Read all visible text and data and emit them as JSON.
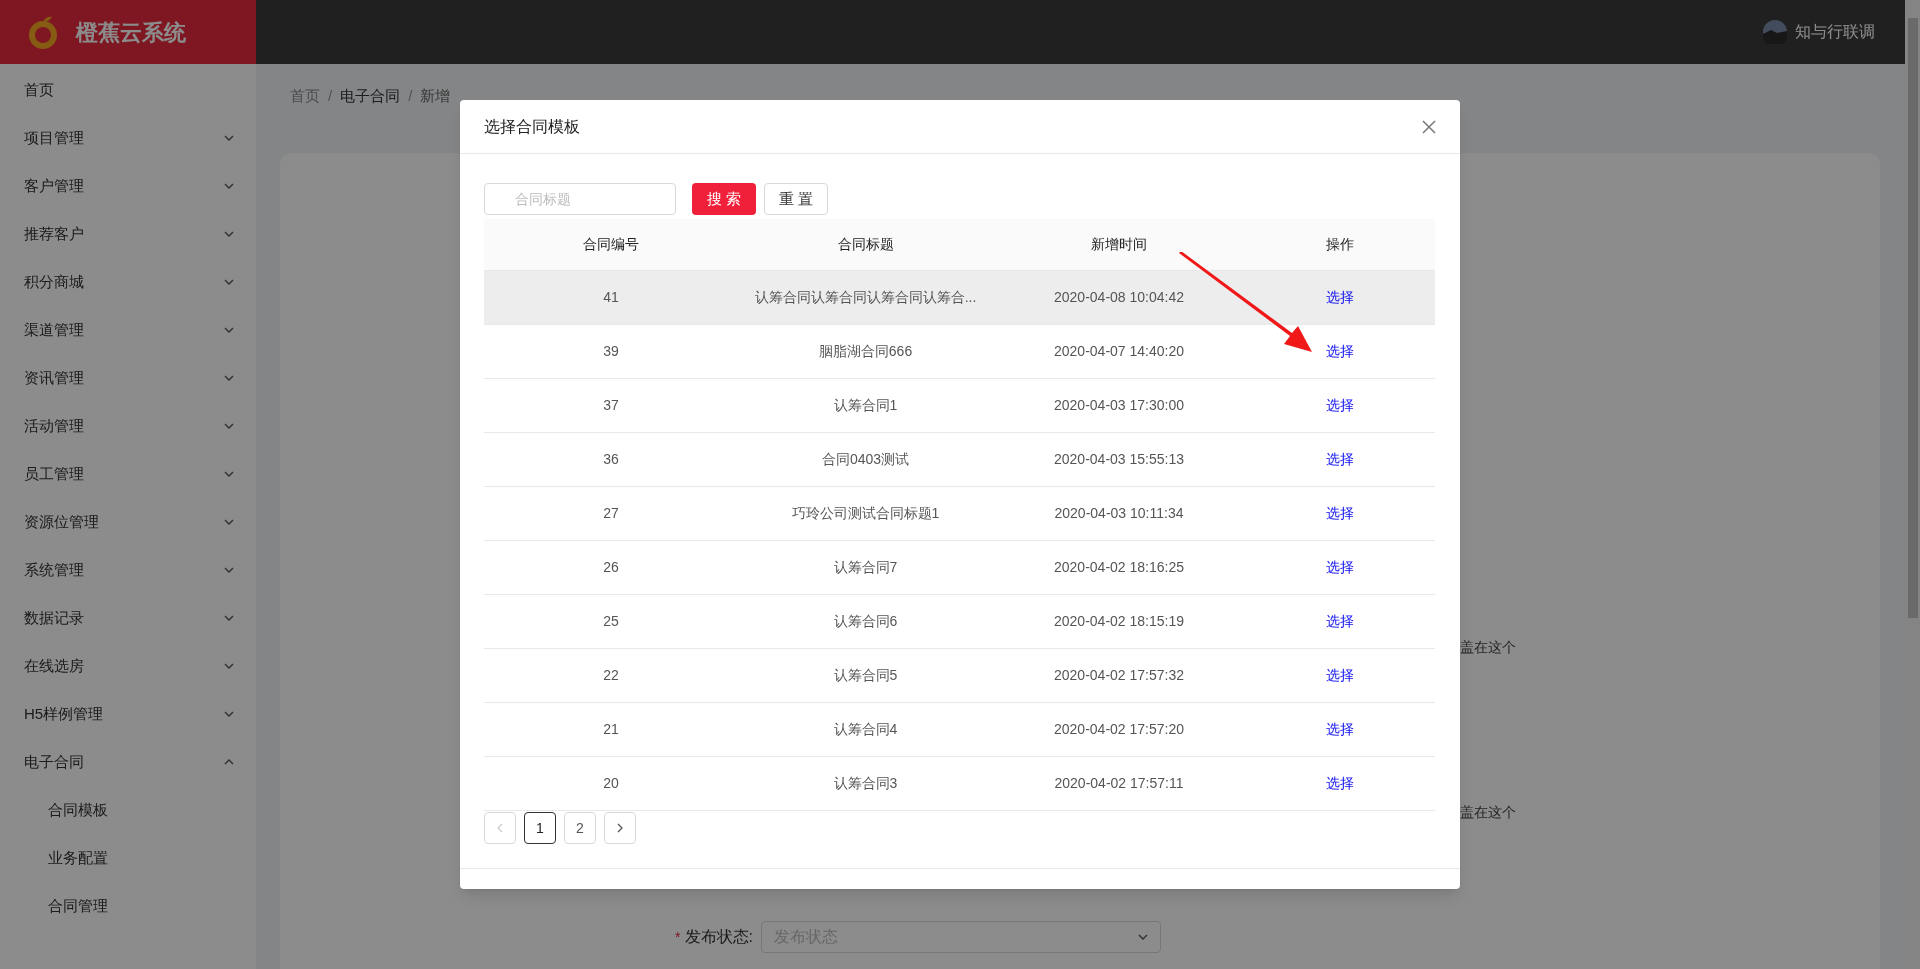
{
  "app": {
    "name": "橙蕉云系统"
  },
  "user": {
    "name": "知与行联调"
  },
  "sidebar": {
    "items": [
      {
        "label": "首页",
        "kind": "link"
      },
      {
        "label": "项目管理",
        "kind": "group",
        "expanded": false
      },
      {
        "label": "客户管理",
        "kind": "group",
        "expanded": false
      },
      {
        "label": "推荐客户",
        "kind": "group",
        "expanded": false
      },
      {
        "label": "积分商城",
        "kind": "group",
        "expanded": false
      },
      {
        "label": "渠道管理",
        "kind": "group",
        "expanded": false
      },
      {
        "label": "资讯管理",
        "kind": "group",
        "expanded": false
      },
      {
        "label": "活动管理",
        "kind": "group",
        "expanded": false
      },
      {
        "label": "员工管理",
        "kind": "group",
        "expanded": false
      },
      {
        "label": "资源位管理",
        "kind": "group",
        "expanded": false
      },
      {
        "label": "系统管理",
        "kind": "group",
        "expanded": false
      },
      {
        "label": "数据记录",
        "kind": "group",
        "expanded": false
      },
      {
        "label": "在线选房",
        "kind": "group",
        "expanded": false
      },
      {
        "label": "H5样例管理",
        "kind": "group",
        "expanded": false
      },
      {
        "label": "电子合同",
        "kind": "group",
        "expanded": true,
        "children": [
          {
            "label": "合同模板"
          },
          {
            "label": "业务配置"
          },
          {
            "label": "合同管理"
          }
        ]
      }
    ]
  },
  "breadcrumb": {
    "separator": "/",
    "items": [
      "首页",
      "电子合同",
      "新增"
    ]
  },
  "background_form": {
    "hints": [
      "盖在这个",
      "盖在这个"
    ],
    "fields": [
      {
        "label": "发布状态:",
        "required": true,
        "required_marker": "*",
        "placeholder": "发布状态"
      }
    ]
  },
  "modal": {
    "title": "选择合同模板",
    "search": {
      "placeholder": "合同标题"
    },
    "buttons": [
      {
        "label": "搜 索",
        "kind": "primary"
      },
      {
        "label": "重 置",
        "kind": "default"
      }
    ],
    "table": {
      "columns": [
        "合同编号",
        "合同标题",
        "新增时间",
        "操作"
      ],
      "rows": [
        {
          "cells": [
            "41",
            "认筹合同认筹合同认筹合同认筹合...",
            "2020-04-08 10:04:42"
          ],
          "action": "选择",
          "selected": true
        },
        {
          "cells": [
            "39",
            "胭脂湖合同666",
            "2020-04-07 14:40:20"
          ],
          "action": "选择",
          "selected": false
        },
        {
          "cells": [
            "37",
            "认筹合同1",
            "2020-04-03 17:30:00"
          ],
          "action": "选择",
          "selected": false
        },
        {
          "cells": [
            "36",
            "合同0403测试",
            "2020-04-03 15:55:13"
          ],
          "action": "选择",
          "selected": false
        },
        {
          "cells": [
            "27",
            "巧玲公司测试合同标题1",
            "2020-04-03 10:11:34"
          ],
          "action": "选择",
          "selected": false
        },
        {
          "cells": [
            "26",
            "认筹合同7",
            "2020-04-02 18:16:25"
          ],
          "action": "选择",
          "selected": false
        },
        {
          "cells": [
            "25",
            "认筹合同6",
            "2020-04-02 18:15:19"
          ],
          "action": "选择",
          "selected": false
        },
        {
          "cells": [
            "22",
            "认筹合同5",
            "2020-04-02 17:57:32"
          ],
          "action": "选择",
          "selected": false
        },
        {
          "cells": [
            "21",
            "认筹合同4",
            "2020-04-02 17:57:20"
          ],
          "action": "选择",
          "selected": false
        },
        {
          "cells": [
            "20",
            "认筹合同3",
            "2020-04-02 17:57:11"
          ],
          "action": "选择",
          "selected": false
        }
      ]
    },
    "pagination": {
      "prev": {
        "disabled": true
      },
      "next": {
        "disabled": false
      },
      "pages": [
        {
          "label": "1",
          "selected": true
        },
        {
          "label": "2",
          "selected": false
        }
      ]
    }
  }
}
